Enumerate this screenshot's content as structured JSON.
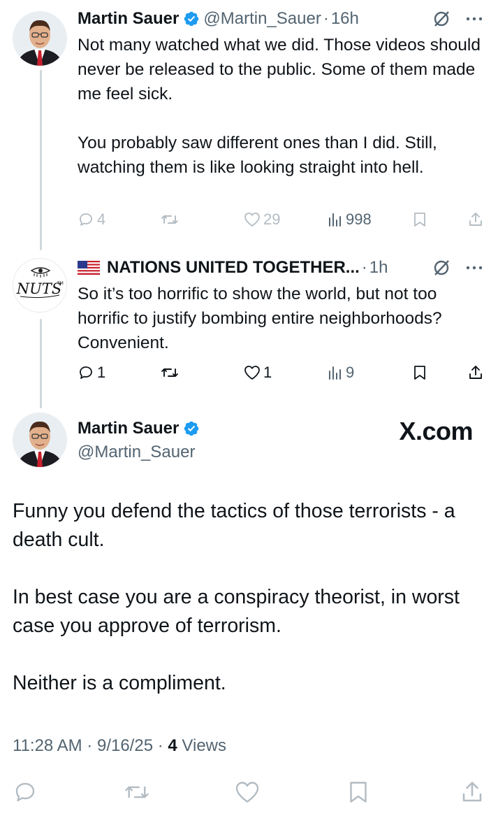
{
  "posts": [
    {
      "author_name": "Martin Sauer",
      "handle": "@Martin_Sauer",
      "time": "16h",
      "text": "Not many watched what we did. Those videos should never be released to the public. Some of them made me feel sick.\n\nYou probably saw different ones than I did. Still, watching them is like looking straight into hell.",
      "stats": {
        "replies": "4",
        "reposts": "",
        "likes": "29",
        "views": "998"
      }
    },
    {
      "author_name": "NATIONS UNITED TOGETHER...",
      "time": "1h",
      "avatar_text": "NUTS",
      "avatar_tm": "TM",
      "text": "So it’s too horrific to show the world, but not too horrific to justify bombing entire neighborhoods? Convenient.",
      "stats": {
        "replies": "1",
        "reposts": "",
        "likes": "1",
        "views": "9"
      }
    }
  ],
  "main_post": {
    "author_name": "Martin Sauer",
    "handle": "@Martin_Sauer",
    "watermark": "X.com",
    "text": "Funny you defend the tactics of those terrorists - a death cult.\n\nIn best case you are a conspiracy theorist, in worst case you approve of terrorism.\n\nNeither is a compliment.",
    "time": "11:28 AM",
    "date": "9/16/25",
    "views_count": "4",
    "views_label": "Views"
  },
  "icons": {
    "verified": "verified-badge-icon",
    "grok": "grok-icon",
    "more": "more-dots-icon",
    "reply": "reply-icon",
    "repost": "repost-icon",
    "like": "heart-icon",
    "views": "views-chart-icon",
    "bookmark": "bookmark-icon",
    "share": "share-icon"
  },
  "colors": {
    "verified_blue": "#1d9bf0",
    "text": "#0f1419",
    "muted": "#536471",
    "faded": "#b3bcc3",
    "thread_line": "#cfd9de"
  }
}
